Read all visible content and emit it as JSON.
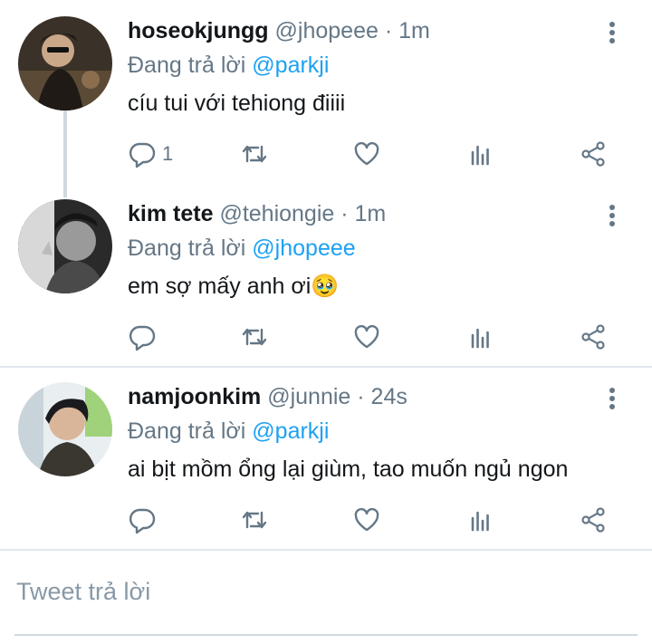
{
  "tweets": [
    {
      "display_name": "hoseokjungg",
      "handle": "@jhopeee",
      "dot": "·",
      "time": "1m",
      "reply_prefix": "Đang trả lời",
      "reply_to": "@parkji",
      "text": "cíu tui với tehiong điiii",
      "reply_count": "1"
    },
    {
      "display_name": "kim tete",
      "handle": "@tehiongie",
      "dot": "·",
      "time": "1m",
      "reply_prefix": "Đang trả lời",
      "reply_to": "@jhopeee",
      "text": "em sợ mấy anh ơi🥹",
      "reply_count": ""
    },
    {
      "display_name": "namjoonkim",
      "handle": "@junnie",
      "dot": "·",
      "time": "24s",
      "reply_prefix": "Đang trả lời",
      "reply_to": "@parkji",
      "text": "ai bịt mồm ổng lại giùm, tao muốn ngủ ngon",
      "reply_count": ""
    }
  ],
  "compose": {
    "placeholder": "Tweet trả lời"
  },
  "icons": [
    "reply-icon",
    "retweet-icon",
    "like-icon",
    "analytics-icon",
    "share-icon",
    "more-icon"
  ],
  "colors": {
    "mention": "#1da1f2",
    "muted": "#657786",
    "text": "#14171a",
    "divider": "#e1e8ed"
  }
}
